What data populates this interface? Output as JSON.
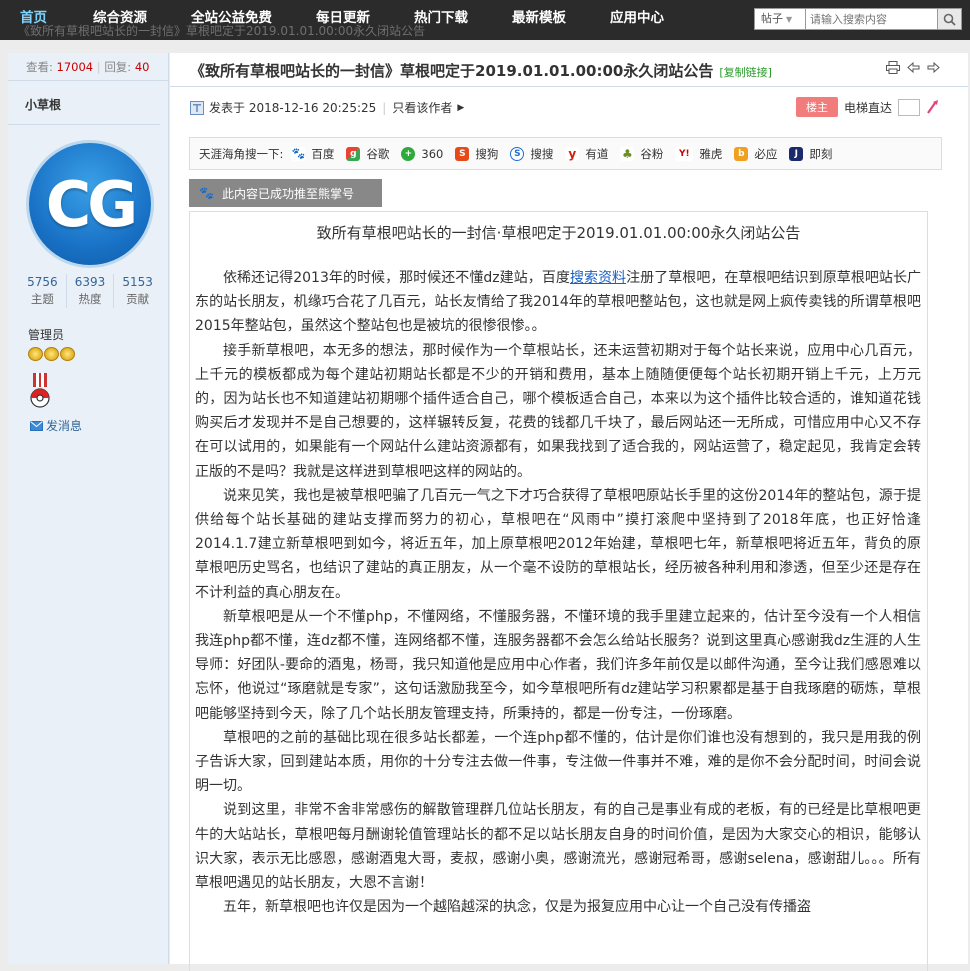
{
  "nav": {
    "items": [
      "首页",
      "综合资源",
      "全站公益免费",
      "每日更新",
      "热门下载",
      "最新模板",
      "应用中心"
    ],
    "active_color": "#7fd4ff"
  },
  "breadcrumb": "《致所有草根吧站长的一封信》草根吧定于2019.01.01.00:00永久闭站公告",
  "search": {
    "type_label": "帖子",
    "placeholder": "请输入搜索内容"
  },
  "sidebar": {
    "views_label": "查看:",
    "views": "17004",
    "replies_label": "回复:",
    "replies": "40",
    "username": "小草根",
    "avatar_text": "CG",
    "counts": [
      {
        "num": "5756",
        "label": "主题"
      },
      {
        "num": "6393",
        "label": "热度"
      },
      {
        "num": "5153",
        "label": "贡献"
      }
    ],
    "role": "管理员",
    "message_link": "发消息"
  },
  "post": {
    "title": "《致所有草根吧站长的一封信》草根吧定于2019.01.01.00:00永久闭站公告",
    "copy_link": "[复制链接]",
    "posted_at": "发表于 2018-12-16 20:25:25",
    "author_only": "只看该作者",
    "floor_badge": "楼主",
    "elevator": "电梯直达",
    "search_label": "天涯海角搜一下:",
    "engines": [
      {
        "name": "百度",
        "color": "#2932e1",
        "glyph": "🐾"
      },
      {
        "name": "谷歌",
        "color": "#34a853",
        "glyph": "g"
      },
      {
        "name": "360",
        "color": "#2eaa3c",
        "glyph": "+"
      },
      {
        "name": "搜狗",
        "color": "#e64a19",
        "glyph": "S"
      },
      {
        "name": "搜搜",
        "color": "#1e6fd9",
        "glyph": "S"
      },
      {
        "name": "有道",
        "color": "#d81e06",
        "glyph": "y"
      },
      {
        "name": "谷粉",
        "color": "#6a8e23",
        "glyph": "♣"
      },
      {
        "name": "雅虎",
        "color": "#cc0000",
        "glyph": "Y!"
      },
      {
        "name": "必应",
        "color": "#f0a020",
        "glyph": "b"
      },
      {
        "name": "即刻",
        "color": "#1a2a6c",
        "glyph": "J"
      }
    ],
    "push_button": "此内容已成功推至熊掌号",
    "article_title": "致所有草根吧站长的一封信·草根吧定于2019.01.01.00:00永久闭站公告",
    "paragraphs": [
      {
        "before": "依稀还记得2013年的时候，那时候还不懂dz建站，百度",
        "link": "搜索资料",
        "after": "注册了草根吧，在草根吧结识到原草根吧站长广东的站长朋友，机缘巧合花了几百元，站长友情给了我2014年的草根吧整站包，这也就是网上疯传卖钱的所谓草根吧2015年整站包，虽然这个整站包也是被坑的很惨很惨。。"
      },
      {
        "text": "接手新草根吧，本无多的想法，那时候作为一个草根站长，还未运营初期对于每个站长来说，应用中心几百元，上千元的模板都成为每个建站初期站长都是不少的开销和费用，基本上随随便便每个站长初期开销上千元，上万元的，因为站长也不知道建站初期哪个插件适合自己，哪个模板适合自己，本来以为这个插件比较合适的，谁知道花钱购买后才发现并不是自己想要的，这样辗转反复，花费的钱都几千块了，最后网站还一无所成，可惜应用中心又不存在可以试用的，如果能有一个网站什么建站资源都有，如果我找到了适合我的，网站运营了，稳定起见，我肯定会转正版的不是吗？我就是这样进到草根吧这样的网站的。"
      },
      {
        "text": "说来见笑，我也是被草根吧骗了几百元一气之下才巧合获得了草根吧原站长手里的这份2014年的整站包，源于提供给每个站长基础的建站支撑而努力的初心，草根吧在“风雨中”摸打滚爬中坚持到了2018年底，也正好恰逢2014.1.7建立新草根吧到如今，将近五年，加上原草根吧2012年始建，草根吧七年，新草根吧将近五年，背负的原草根吧历史骂名，也结识了建站的真正朋友，从一个毫不设防的草根站长，经历被各种利用和渗透，但至少还是存在不计利益的真心朋友在。"
      },
      {
        "text": "新草根吧是从一个不懂php，不懂网络，不懂服务器，不懂环境的我手里建立起来的，估计至今没有一个人相信我连php都不懂，连dz都不懂，连网络都不懂，连服务器都不会怎么给站长服务？说到这里真心感谢我dz生涯的人生导师：好团队-要命的酒鬼，杨哥，我只知道他是应用中心作者，我们许多年前仅是以邮件沟通，至今让我们感恩难以忘怀，他说过“琢磨就是专家”，这句话激励我至今，如今草根吧所有dz建站学习积累都是基于自我琢磨的砺炼，草根吧能够坚持到今天，除了几个站长朋友管理支持，所秉持的，都是一份专注，一份琢磨。"
      },
      {
        "text": "草根吧的之前的基础比现在很多站长都差，一个连php都不懂的，估计是你们谁也没有想到的，我只是用我的例子告诉大家，回到建站本质，用你的十分专注去做一件事，专注做一件事并不难，难的是你不会分配时间，时间会说明一切。"
      },
      {
        "text": "说到这里，非常不舍非常感伤的解散管理群几位站长朋友，有的自己是事业有成的老板，有的已经是比草根吧更牛的大站站长，草根吧每月酬谢轮值管理站长的都不足以站长朋友自身的时间价值，是因为大家交心的相识，能够认识大家，表示无比感恩，感谢酒鬼大哥，麦叔，感谢小奥，感谢流光，感谢冠希哥，感谢selena，感谢甜儿。。。所有草根吧遇见的站长朋友，大恩不言谢！"
      },
      {
        "text": "五年，新草根吧也许仅是因为一个越陷越深的执念，仅是为报复应用中心让一个自己没有传播盗"
      }
    ]
  }
}
